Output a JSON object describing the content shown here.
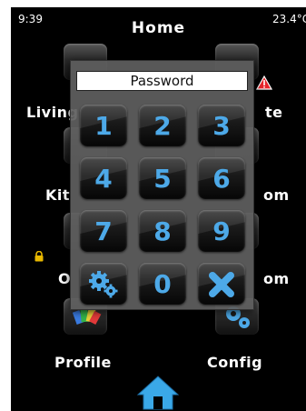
{
  "status": {
    "time": "9:39",
    "temperature": "23.4°C"
  },
  "header": {
    "title": "Home"
  },
  "tiles": {
    "living": {
      "label": "Living"
    },
    "right1": {
      "label": "te"
    },
    "kitchen": {
      "label": "Kit"
    },
    "right2": {
      "label": "om"
    },
    "left3": {
      "label": "O"
    },
    "right3": {
      "label": "om"
    },
    "profile": {
      "label": "Profile"
    },
    "config": {
      "label": "Config"
    }
  },
  "keypad": {
    "password_placeholder": "Password",
    "keys": [
      "1",
      "2",
      "3",
      "4",
      "5",
      "6",
      "7",
      "8",
      "9",
      "0"
    ]
  },
  "colors": {
    "accent": "#4da9e8",
    "warning": "#e8262c"
  }
}
